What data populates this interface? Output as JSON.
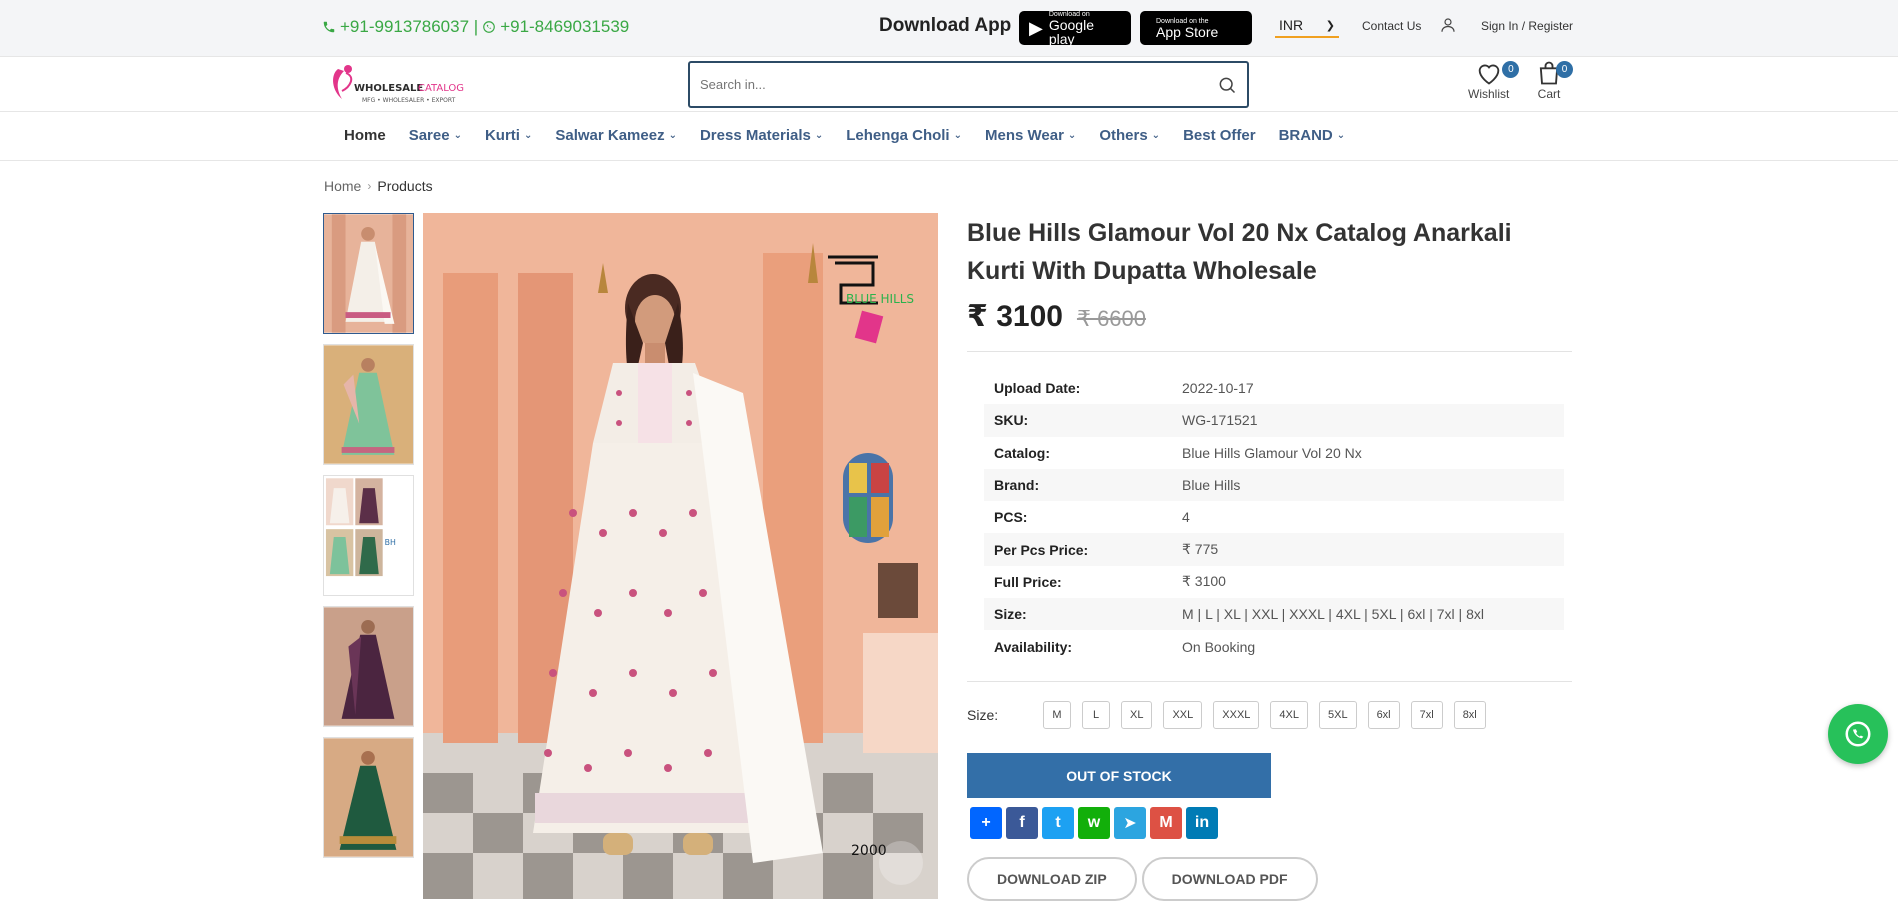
{
  "topbar": {
    "phones": "+91-9913786037 | ",
    "phone2": "+91-8469031539",
    "download_app": "Download App",
    "google_play_small": "Download on",
    "google_play_big": "Google play",
    "app_store_small": "Download on the",
    "app_store_big": "App Store",
    "currency": "INR",
    "contact": "Contact Us",
    "signin": "Sign In / Register"
  },
  "header": {
    "logo_text": "WHOLESALE CATALOG",
    "logo_tagline": "MFG • WHOLESALER • EXPORT",
    "search_placeholder": "Search in...",
    "wishlist_label": "Wishlist",
    "wishlist_count": "0",
    "cart_label": "Cart",
    "cart_count": "0"
  },
  "nav": [
    {
      "label": "Home",
      "dropdown": false
    },
    {
      "label": "Saree",
      "dropdown": true
    },
    {
      "label": "Kurti",
      "dropdown": true
    },
    {
      "label": "Salwar Kameez",
      "dropdown": true
    },
    {
      "label": "Dress Materials",
      "dropdown": true
    },
    {
      "label": "Lehenga Choli",
      "dropdown": true
    },
    {
      "label": "Mens Wear",
      "dropdown": true
    },
    {
      "label": "Others",
      "dropdown": true
    },
    {
      "label": "Best Offer",
      "dropdown": false
    },
    {
      "label": "BRAND",
      "dropdown": true
    }
  ],
  "breadcrumb": {
    "home": "Home",
    "current": "Products"
  },
  "product": {
    "title": "Blue Hills Glamour Vol 20 Nx Catalog Anarkali Kurti With Dupatta Wholesale",
    "price": "₹ 3100",
    "old_price": "₹ 6600",
    "specs": [
      {
        "k": "Upload Date:",
        "v": "2022-10-17"
      },
      {
        "k": "SKU:",
        "v": "WG-171521"
      },
      {
        "k": "Catalog:",
        "v": "Blue Hills Glamour Vol 20 Nx"
      },
      {
        "k": "Brand:",
        "v": "Blue Hills"
      },
      {
        "k": "PCS:",
        "v": "4"
      },
      {
        "k": "Per Pcs Price:",
        "v": "₹ 775"
      },
      {
        "k": "Full Price:",
        "v": "₹ 3100"
      },
      {
        "k": "Size:",
        "v": "M | L | XL | XXL | XXXL | 4XL | 5XL | 6xl | 7xl | 8xl"
      },
      {
        "k": "Availability:",
        "v": "On Booking"
      }
    ],
    "size_label": "Size:",
    "sizes": [
      "M",
      "L",
      "XL",
      "XXL",
      "XXXL",
      "4XL",
      "5XL",
      "6xl",
      "7xl",
      "8xl"
    ],
    "out_of_stock": "OUT OF STOCK",
    "download_zip": "DOWNLOAD ZIP",
    "download_pdf": "DOWNLOAD PDF",
    "image_brand": "BLUE HILLS",
    "image_code": "2000"
  },
  "share": [
    {
      "name": "share-plus-icon",
      "color": "#0166ff",
      "glyph": "+"
    },
    {
      "name": "facebook-icon",
      "color": "#3b5998",
      "glyph": "f"
    },
    {
      "name": "twitter-icon",
      "color": "#1da1f2",
      "glyph": "t"
    },
    {
      "name": "whatsapp-icon",
      "color": "#12af0a",
      "glyph": "w"
    },
    {
      "name": "telegram-icon",
      "color": "#2ca5e0",
      "glyph": "➤"
    },
    {
      "name": "gmail-icon",
      "color": "#dd5144",
      "glyph": "M"
    },
    {
      "name": "linkedin-icon",
      "color": "#007bb5",
      "glyph": "in"
    }
  ],
  "colors": {
    "accent": "#336fa8",
    "nav_text": "#3f5e86",
    "phone_green": "#3aa845",
    "whatsapp": "#27c15a"
  }
}
